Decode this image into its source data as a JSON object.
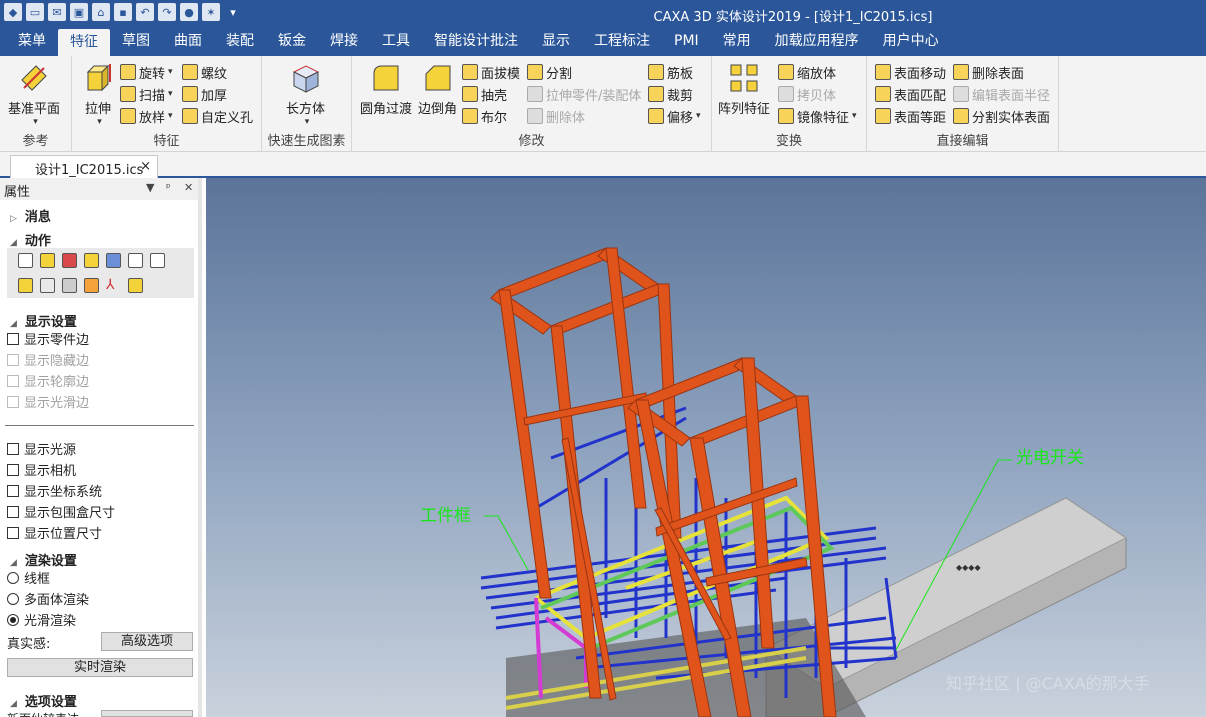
{
  "window": {
    "title": "CAXA 3D 实体设计2019 - [设计1_IC2015.ics]"
  },
  "quick_access": [
    "cube-logo-icon",
    "new-icon",
    "mail-icon",
    "image-icon",
    "open-folder-icon",
    "save-icon",
    "undo-icon",
    "redo-icon",
    "sphere-icon",
    "design-icon",
    "dropdown-icon"
  ],
  "tabs": [
    "菜单",
    "特征",
    "草图",
    "曲面",
    "装配",
    "钣金",
    "焊接",
    "工具",
    "智能设计批注",
    "显示",
    "工程标注",
    "PMI",
    "常用",
    "加载应用程序",
    "用户中心"
  ],
  "active_tab": "特征",
  "ribbon": {
    "ref": {
      "label": "参考",
      "base_plane": "基准平面"
    },
    "feature": {
      "label": "特征",
      "extrude": "拉伸",
      "revolve": "旋转",
      "sweep": "扫描",
      "loft": "放样",
      "thread": "螺纹",
      "thicken": "加厚",
      "custom_hole": "自定义孔"
    },
    "quick": {
      "label": "快速生成图素",
      "box": "长方体"
    },
    "modify": {
      "label": "修改",
      "fillet": "圆角过渡",
      "chamfer": "边倒角",
      "draft": "面拔模",
      "shell": "抽壳",
      "boolean": "布尔",
      "split": "分割",
      "stretch_part": "拉伸零件/装配体",
      "delete_body": "删除体",
      "rib": "筋板",
      "trim": "裁剪",
      "offset": "偏移"
    },
    "transform": {
      "label": "变换",
      "pattern": "阵列特征",
      "scale": "缩放体",
      "copy": "拷贝体",
      "mirror": "镜像特征"
    },
    "direct": {
      "label": "直接编辑",
      "move_face": "表面移动",
      "match_face": "表面匹配",
      "equal_face": "表面等距",
      "delete_face": "删除表面",
      "edit_radius": "编辑表面半径",
      "split_face": "分割实体表面"
    }
  },
  "doc_tab": {
    "name": "设计1_IC2015.ics",
    "close": "×"
  },
  "panel": {
    "title": "属性",
    "header_buttons": [
      "▼",
      "ᵖ",
      "✕"
    ],
    "sec_message": "消息",
    "sec_action": "动作",
    "sec_display": "显示设置",
    "display_items": [
      {
        "label": "显示零件边",
        "enabled": true
      },
      {
        "label": "显示隐藏边",
        "enabled": false
      },
      {
        "label": "显示轮廓边",
        "enabled": false
      },
      {
        "label": "显示光滑边",
        "enabled": false
      }
    ],
    "more_items": [
      "显示光源",
      "显示相机",
      "显示坐标系统",
      "显示包围盒尺寸",
      "显示位置尺寸"
    ],
    "sec_render": "渲染设置",
    "render_modes": [
      "线框",
      "多面体渲染",
      "光滑渲染"
    ],
    "render_selected": "光滑渲染",
    "realism_label": "真实感:",
    "advanced_btn": "高级选项",
    "realtime_btn": "实时渲染",
    "sec_options": "选项设置",
    "truncated_label": "新面仙较表达"
  },
  "scene": {
    "annotations": [
      "工件框",
      "光电开关"
    ],
    "annotation_color": "#19e619",
    "frame_color": "#e0541c",
    "box_label": "◆◆◆◆",
    "watermark": "知乎社区 | @CAXA的那大手"
  },
  "colors": {
    "accent": "#2b579a",
    "ribbon_bg": "#f3f3f3"
  }
}
